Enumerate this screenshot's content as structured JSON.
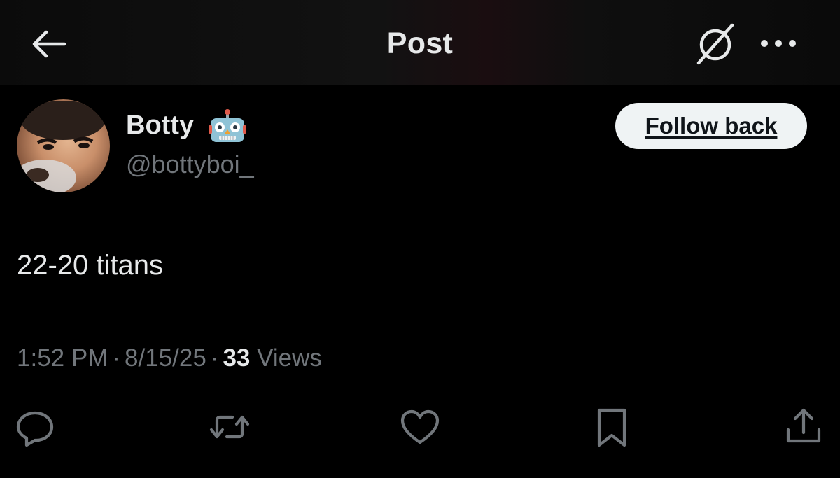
{
  "header": {
    "title": "Post",
    "back_icon": "arrow-left-icon",
    "grok_icon": "grok-icon",
    "more_icon": "more-horizontal-icon"
  },
  "author": {
    "display_name": "Botty",
    "name_emoji": "robot-emoji",
    "handle": "@bottyboi_",
    "follow_label": "Follow back"
  },
  "post": {
    "text": "22-20 titans",
    "time": "1:52 PM",
    "date": "8/15/25",
    "separator": "·",
    "views_count": "33",
    "views_label": "Views"
  },
  "actions": [
    {
      "name": "reply",
      "icon": "reply-icon"
    },
    {
      "name": "repost",
      "icon": "repost-icon"
    },
    {
      "name": "like",
      "icon": "heart-icon"
    },
    {
      "name": "bookmark",
      "icon": "bookmark-icon"
    },
    {
      "name": "share",
      "icon": "share-icon"
    }
  ],
  "colors": {
    "background": "#000000",
    "text_primary": "#e7e9ea",
    "text_secondary": "#71767b",
    "button_bg": "#eff3f4",
    "button_text": "#0f1419"
  }
}
